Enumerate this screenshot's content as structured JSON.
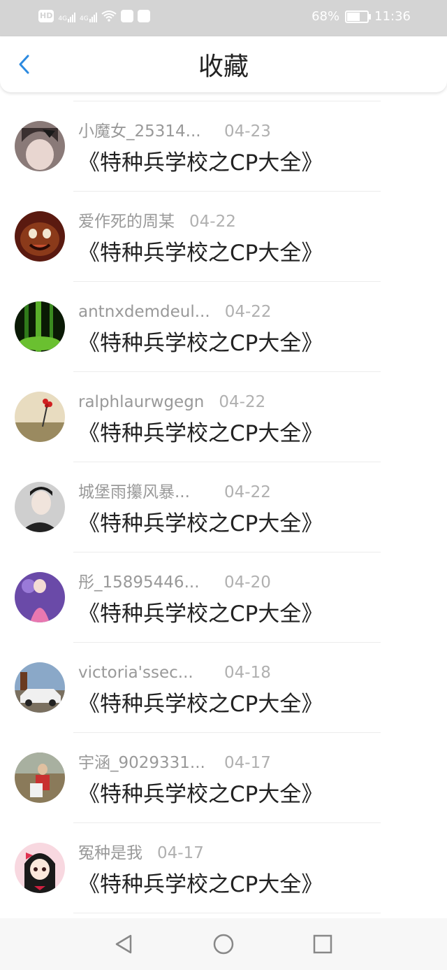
{
  "status_bar": {
    "hd_label": "HD",
    "network_1": "4G",
    "network_2": "4G",
    "battery_text": "68%",
    "battery_level": 0.68,
    "time": "11:36"
  },
  "header": {
    "title": "收藏",
    "back_icon": "chevron-left-icon"
  },
  "colors": {
    "accent": "#2c8ae0",
    "status_bar_bg": "#d4d4d4",
    "meta_text": "#999999",
    "title_text": "#222222"
  },
  "favorites": [
    {
      "name": "小魔女_25314...",
      "date": "04-23",
      "title": "《特种兵学校之CP大全》"
    },
    {
      "name": "爱作死的周某",
      "date": "04-22",
      "title": "《特种兵学校之CP大全》"
    },
    {
      "name": "antnxdemdeul...",
      "date": "04-22",
      "title": "《特种兵学校之CP大全》"
    },
    {
      "name": "ralphlaurwgegn",
      "date": "04-22",
      "title": "《特种兵学校之CP大全》"
    },
    {
      "name": "城堡雨攥风暴...",
      "date": "04-22",
      "title": "《特种兵学校之CP大全》"
    },
    {
      "name": "彤_15895446...",
      "date": "04-20",
      "title": "《特种兵学校之CP大全》"
    },
    {
      "name": "victoria'ssec...",
      "date": "04-18",
      "title": "《特种兵学校之CP大全》"
    },
    {
      "name": "宇涵_9029331...",
      "date": "04-17",
      "title": "《特种兵学校之CP大全》"
    },
    {
      "name": "冤种是我",
      "date": "04-17",
      "title": "《特种兵学校之CP大全》"
    }
  ],
  "nav_bar": {
    "back": "triangle-back-icon",
    "home": "circle-home-icon",
    "recents": "square-recents-icon"
  }
}
